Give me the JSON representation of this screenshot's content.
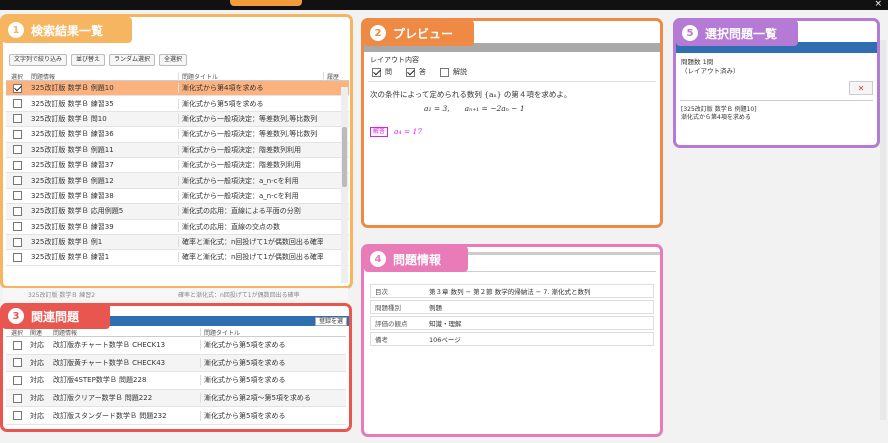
{
  "window": {
    "close_glyph": "×"
  },
  "panels": {
    "search": {
      "num": "1",
      "title": "検索結果一覧"
    },
    "preview": {
      "num": "2",
      "title": "プレビュー"
    },
    "related": {
      "num": "3",
      "title": "関連問題"
    },
    "info": {
      "num": "4",
      "title": "問題情報"
    },
    "selected": {
      "num": "5",
      "title": "選択問題一覧"
    }
  },
  "search": {
    "toolbar": [
      "文字列で絞り込み",
      "並び替え",
      "ランダム選択",
      "全選択"
    ],
    "headers": {
      "select": "選択",
      "question": "問題情報",
      "title": "問題タイトル",
      "history": "履歴"
    },
    "rows": [
      {
        "checked": true,
        "question": "325改訂版 数学Ｂ 例題10",
        "title": "漸化式から第4項を求める",
        "selected": true
      },
      {
        "checked": false,
        "question": "325改訂版 数学Ｂ 練習35",
        "title": "漸化式から第5項を求める"
      },
      {
        "checked": false,
        "question": "325改訂版 数学Ｂ 問10",
        "title": "漸化式から一般項決定：等差数列,等比数列"
      },
      {
        "checked": false,
        "question": "325改訂版 数学Ｂ 練習36",
        "title": "漸化式から一般項決定：等差数列,等比数列"
      },
      {
        "checked": false,
        "question": "325改訂版 数学Ｂ 例題11",
        "title": "漸化式から一般項決定：階差数列利用"
      },
      {
        "checked": false,
        "question": "325改訂版 数学Ｂ 練習37",
        "title": "漸化式から一般項決定：階差数列利用"
      },
      {
        "checked": false,
        "question": "325改訂版 数学Ｂ 例題12",
        "title": "漸化式から一般項決定：a_n-cを利用"
      },
      {
        "checked": false,
        "question": "325改訂版 数学Ｂ 練習38",
        "title": "漸化式から一般項決定：a_n-cを利用"
      },
      {
        "checked": false,
        "question": "325改訂版 数学Ｂ 応用例題5",
        "title": "漸化式の応用：直線による平面の分割"
      },
      {
        "checked": false,
        "question": "325改訂版 数学Ｂ 練習39",
        "title": "漸化式の応用：直線の交点の数"
      },
      {
        "checked": false,
        "question": "325改訂版 数学Ｂ 例1",
        "title": "確率と漸化式：n回投げて1が偶数回出る確率"
      },
      {
        "checked": false,
        "question": "325改訂版 数学Ｂ 練習1",
        "title": "確率と漸化式：n回投げて1が偶数回出る確率"
      }
    ],
    "behind_row": {
      "question": "325改訂版 数学Ｂ 練習2",
      "title": "確率と漸化式：n回投げて1が偶数回出る確率"
    }
  },
  "preview": {
    "layout_label": "レイアウト内容",
    "options": [
      {
        "label": "問",
        "checked": true
      },
      {
        "label": "答",
        "checked": true
      },
      {
        "label": "解説",
        "checked": false
      }
    ],
    "question": "次の条件によって定められる数列 {aₙ} の第４項を求めよ。",
    "formula": "a₁ = 3,　　aₙ₊₁ = −2aₙ − 1",
    "answer_tag": "解答",
    "answer": "a₄ = 17"
  },
  "related": {
    "register_button": "登録を選",
    "headers": {
      "select": "選択",
      "relation": "関連",
      "question": "問題情報",
      "title": "問題タイトル"
    },
    "rows": [
      {
        "relation": "対応",
        "question": "改訂版赤チャート数学Ｂ CHECK13",
        "title": "漸化式から第5項を求める"
      },
      {
        "relation": "対応",
        "question": "改訂版黄チャート数学Ｂ CHECK43",
        "title": "漸化式から第5項を求める"
      },
      {
        "relation": "対応",
        "question": "改訂版4STEP数学Ｂ 問題228",
        "title": "漸化式から第5項を求める"
      },
      {
        "relation": "対応",
        "question": "改訂版クリアー数学Ｂ 問題222",
        "title": "漸化式から第2項〜第5項を求める"
      },
      {
        "relation": "対応",
        "question": "改訂版スタンダード数学Ｂ 問題232",
        "title": "漸化式から第5項を求める"
      }
    ]
  },
  "info": {
    "rows": [
      {
        "key": "目次",
        "value": "第３章 数列 − 第２節 数学的帰納法 − 7. 漸化式と数列"
      },
      {
        "key": "問題種別",
        "value": "例題"
      },
      {
        "key": "評価の観点",
        "value": "知識・理解"
      },
      {
        "key": "備考",
        "value": "106ページ"
      }
    ]
  },
  "selected": {
    "count": "問題数 1問",
    "layout": "（レイアウト済み）",
    "delete_icon": "✕",
    "item_name": "[325改訂版 数学Ｂ 例題10]",
    "item_title": "漸化式から第4項を求める"
  }
}
